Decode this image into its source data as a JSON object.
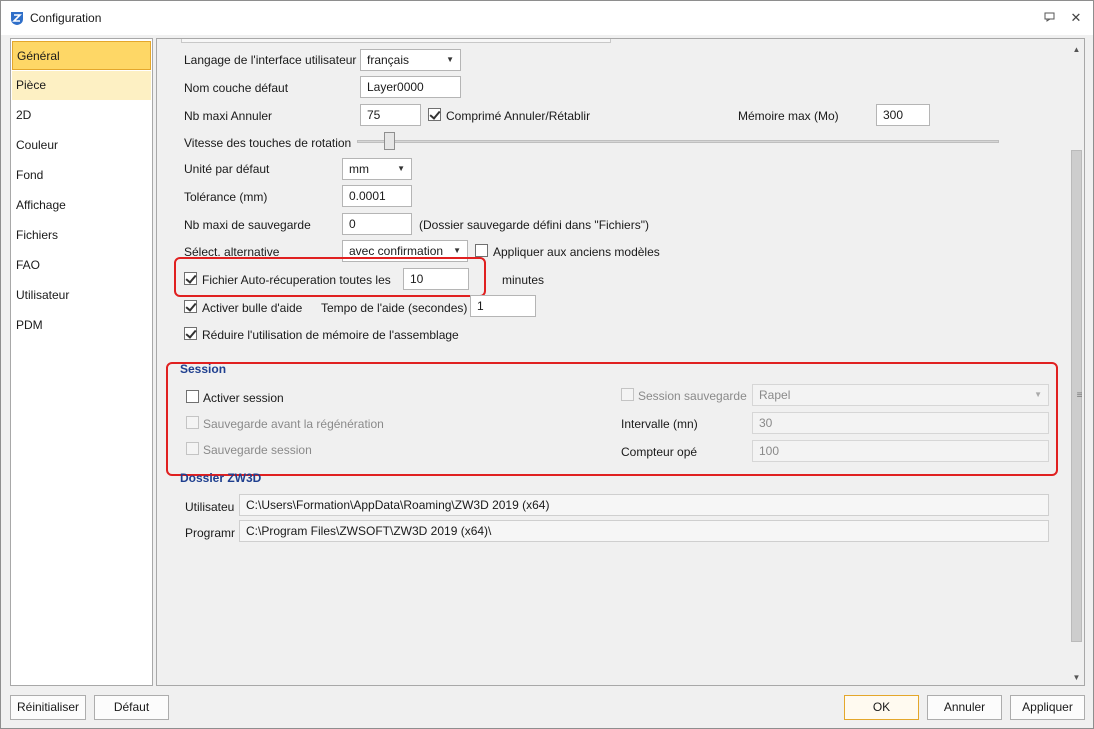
{
  "window": {
    "title": "Configuration"
  },
  "sidebar": {
    "items": [
      {
        "label": "Général"
      },
      {
        "label": "Pièce"
      },
      {
        "label": "2D"
      },
      {
        "label": "Couleur"
      },
      {
        "label": "Fond"
      },
      {
        "label": "Affichage"
      },
      {
        "label": "Fichiers"
      },
      {
        "label": "FAO"
      },
      {
        "label": "Utilisateur"
      },
      {
        "label": "PDM"
      }
    ]
  },
  "general": {
    "lang_label": "Langage de l'interface utilisateur",
    "lang_value": "français",
    "layer_label": "Nom couche défaut",
    "layer_value": "Layer0000",
    "undo_label": "Nb maxi Annuler",
    "undo_value": "75",
    "compress_label": "Comprimé Annuler/Rétablir",
    "mem_label": "Mémoire max (Mo)",
    "mem_value": "300",
    "rotation_label": "Vitesse des touches de rotation",
    "unit_label": "Unité par défaut",
    "unit_value": "mm",
    "tol_label": "Tolérance (mm)",
    "tol_value": "0.0001",
    "save_label": "Nb maxi de sauvegarde",
    "save_value": "0",
    "save_note": "(Dossier sauvegarde défini dans \"Fichiers\")",
    "altsel_label": "Sélect. alternative",
    "altsel_value": "avec confirmation",
    "old_models_label": "Appliquer aux anciens modèles",
    "autorec_label": "Fichier Auto-récuperation toutes les",
    "autorec_value": "10",
    "autorec_unit": "minutes",
    "bubble_label": "Activer bulle d'aide",
    "tempo_label": "Tempo de l'aide (secondes)",
    "tempo_value": "1",
    "reduce_label": "Réduire l'utilisation de mémoire de l'assemblage"
  },
  "session": {
    "title": "Session",
    "activate_label": "Activer session",
    "save_before_label": "Sauvegarde avant la régénération",
    "save_session_label": "Sauvegarde session",
    "session_save_label": "Session sauvegarde",
    "session_save_value": "Rapel",
    "interval_label": "Intervalle (mn)",
    "interval_value": "30",
    "counter_label": "Compteur opé",
    "counter_value": "100"
  },
  "zw3d": {
    "title": "Dossier ZW3D",
    "user_label": "Utilisateu",
    "user_value": "C:\\Users\\Formation\\AppData\\Roaming\\ZW3D 2019 (x64)",
    "prog_label": "Programr",
    "prog_value": "C:\\Program Files\\ZWSOFT\\ZW3D 2019 (x64)\\"
  },
  "buttons": {
    "reset": "Réinitialiser",
    "default": "Défaut",
    "ok": "OK",
    "cancel": "Annuler",
    "apply": "Appliquer"
  },
  "colors": {
    "accent": "#fed766",
    "highlight_box": "#e02020",
    "section_title": "#1f3f8f"
  }
}
